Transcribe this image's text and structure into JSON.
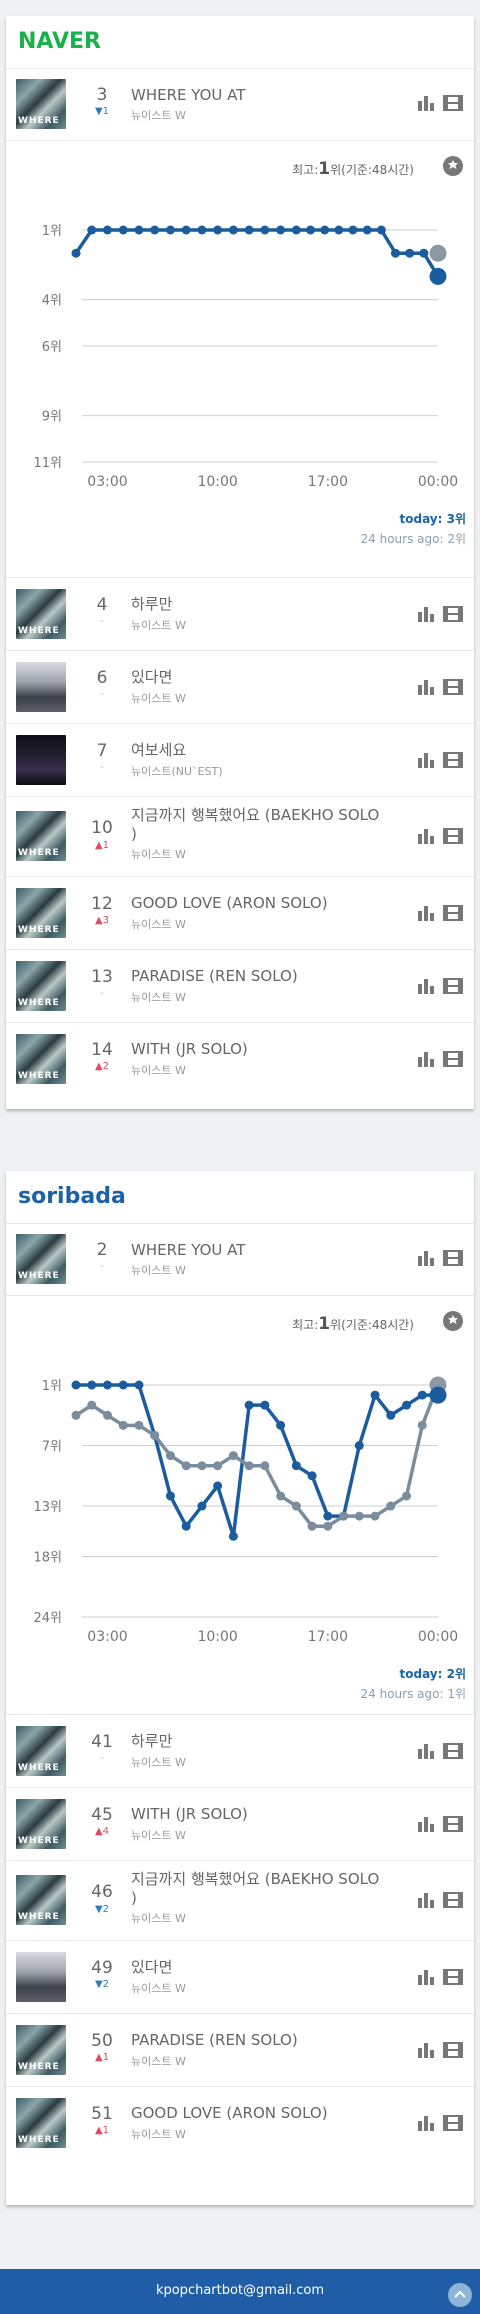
{
  "naver": {
    "title": "NAVER",
    "top_song": {
      "rank": "3",
      "change": "▼1",
      "change_dir": "down",
      "title": "WHERE YOU AT",
      "artist": "뉴이스트 W",
      "thumb": "a"
    },
    "best_label_prefix": "최고:",
    "best_rank": "1",
    "best_label_suffix": "위(기준:48시간)",
    "chart_data": {
      "type": "line",
      "y_ticks": [
        "1위",
        "4위",
        "6위",
        "9위",
        "11위"
      ],
      "y_tick_values": [
        1,
        4,
        6,
        9,
        11
      ],
      "ylim": [
        1,
        11
      ],
      "x_ticks": [
        "03:00",
        "10:00",
        "17:00",
        "00:00"
      ],
      "x_tick_values": [
        3,
        10,
        17,
        24
      ],
      "x_range": [
        1,
        24
      ],
      "series": [
        {
          "color": "#7b8d9d",
          "x": [],
          "values": []
        },
        {
          "color": "#1a5c9e",
          "x": [
            1,
            2,
            3,
            4,
            5,
            6,
            7,
            8,
            9,
            10,
            11,
            12,
            13,
            14,
            15,
            15.9,
            16.8,
            17.7,
            18.6,
            19.5,
            20.4,
            21.3,
            22.2,
            23.1,
            24
          ],
          "values": [
            2,
            1,
            1,
            1,
            1,
            1,
            1,
            1,
            1,
            1,
            1,
            1,
            1,
            1,
            1,
            1,
            1,
            1,
            1,
            1,
            1,
            2,
            2,
            2,
            3
          ]
        }
      ],
      "end_points": {
        "gray": 2,
        "blue": 3
      }
    },
    "today_label": "today: 3위",
    "ago_label": "24 hours ago: 2위",
    "songs": [
      {
        "rank": "4",
        "change": "-",
        "change_dir": "same",
        "title": "하루만",
        "artist": "뉴이스트 W",
        "thumb": "a"
      },
      {
        "rank": "6",
        "change": "-",
        "change_dir": "same",
        "title": "있다면",
        "artist": "뉴이스트 W",
        "thumb": "b"
      },
      {
        "rank": "7",
        "change": "-",
        "change_dir": "same",
        "title": "여보세요",
        "artist": "뉴이스트(NU`EST)",
        "thumb": "c"
      },
      {
        "rank": "10",
        "change": "▲1",
        "change_dir": "up",
        "title": "지금까지 행복했어요 (BAEKHO SOLO\n)",
        "artist": "뉴이스트 W",
        "thumb": "a"
      },
      {
        "rank": "12",
        "change": "▲3",
        "change_dir": "up",
        "title": "GOOD LOVE (ARON SOLO)",
        "artist": "뉴이스트 W",
        "thumb": "a"
      },
      {
        "rank": "13",
        "change": "-",
        "change_dir": "same",
        "title": "PARADISE (REN SOLO)",
        "artist": "뉴이스트 W",
        "thumb": "a"
      },
      {
        "rank": "14",
        "change": "▲2",
        "change_dir": "up",
        "title": "WITH (JR SOLO)",
        "artist": "뉴이스트 W",
        "thumb": "a"
      }
    ]
  },
  "soribada": {
    "title": "soribada",
    "top_song": {
      "rank": "2",
      "change": "-",
      "change_dir": "same",
      "title": "WHERE YOU AT",
      "artist": "뉴이스트 W",
      "thumb": "a"
    },
    "best_label_prefix": "최고:",
    "best_rank": "1",
    "best_label_suffix": "위(기준:48시간)",
    "chart_data": {
      "type": "line",
      "y_ticks": [
        "1위",
        "7위",
        "13위",
        "18위",
        "24위"
      ],
      "y_tick_values": [
        1,
        7,
        13,
        18,
        24
      ],
      "ylim": [
        1,
        24
      ],
      "x_ticks": [
        "03:00",
        "10:00",
        "17:00",
        "00:00"
      ],
      "x_tick_values": [
        3,
        10,
        17,
        24
      ],
      "x_range": [
        1,
        24
      ],
      "series": [
        {
          "color": "#1a5c9e",
          "x": [
            1,
            2,
            3,
            4,
            5,
            6,
            7,
            8,
            9,
            10,
            11,
            12,
            13,
            14,
            15,
            16,
            17,
            18,
            19,
            20,
            21,
            22,
            23,
            24
          ],
          "values": [
            1,
            1,
            1,
            1,
            1,
            6,
            12,
            15,
            13,
            11,
            16,
            3,
            3,
            5,
            9,
            10,
            14,
            14,
            7,
            2,
            4,
            3,
            2,
            2
          ]
        },
        {
          "color": "#7b8d9d",
          "x": [
            1,
            2,
            3,
            4,
            5,
            6,
            7,
            8,
            9,
            10,
            11,
            12,
            13,
            14,
            15,
            16,
            17,
            18,
            19,
            20,
            21,
            22,
            23,
            24
          ],
          "values": [
            4,
            3,
            4,
            5,
            5,
            6,
            8,
            9,
            9,
            9,
            8,
            9,
            9,
            12,
            13,
            15,
            15,
            14,
            14,
            14,
            13,
            12,
            5,
            1
          ]
        }
      ],
      "end_points": {
        "gray": 1,
        "blue": 2
      }
    },
    "today_label": "today: 2위",
    "ago_label": "24 hours ago: 1위",
    "songs": [
      {
        "rank": "41",
        "change": "-",
        "change_dir": "same",
        "title": "하루만",
        "artist": "뉴이스트 W",
        "thumb": "a"
      },
      {
        "rank": "45",
        "change": "▲4",
        "change_dir": "up",
        "title": "WITH (JR SOLO)",
        "artist": "뉴이스트 W",
        "thumb": "a"
      },
      {
        "rank": "46",
        "change": "▼2",
        "change_dir": "down",
        "title": "지금까지 행복했어요 (BAEKHO SOLO\n)",
        "artist": "뉴이스트 W",
        "thumb": "a"
      },
      {
        "rank": "49",
        "change": "▼2",
        "change_dir": "down",
        "title": "있다면",
        "artist": "뉴이스트 W",
        "thumb": "b"
      },
      {
        "rank": "50",
        "change": "▲1",
        "change_dir": "up",
        "title": "PARADISE (REN SOLO)",
        "artist": "뉴이스트 W",
        "thumb": "a"
      },
      {
        "rank": "51",
        "change": "▲1",
        "change_dir": "up",
        "title": "GOOD LOVE (ARON SOLO)",
        "artist": "뉴이스트 W",
        "thumb": "a"
      }
    ]
  },
  "footer": {
    "email": "kpopchartbot@gmail.com",
    "scroll_top_icon": "chevron-up-icon"
  },
  "icons": {
    "chart": "bar-chart-icon",
    "video": "film-icon",
    "settings": "gear-icon"
  }
}
